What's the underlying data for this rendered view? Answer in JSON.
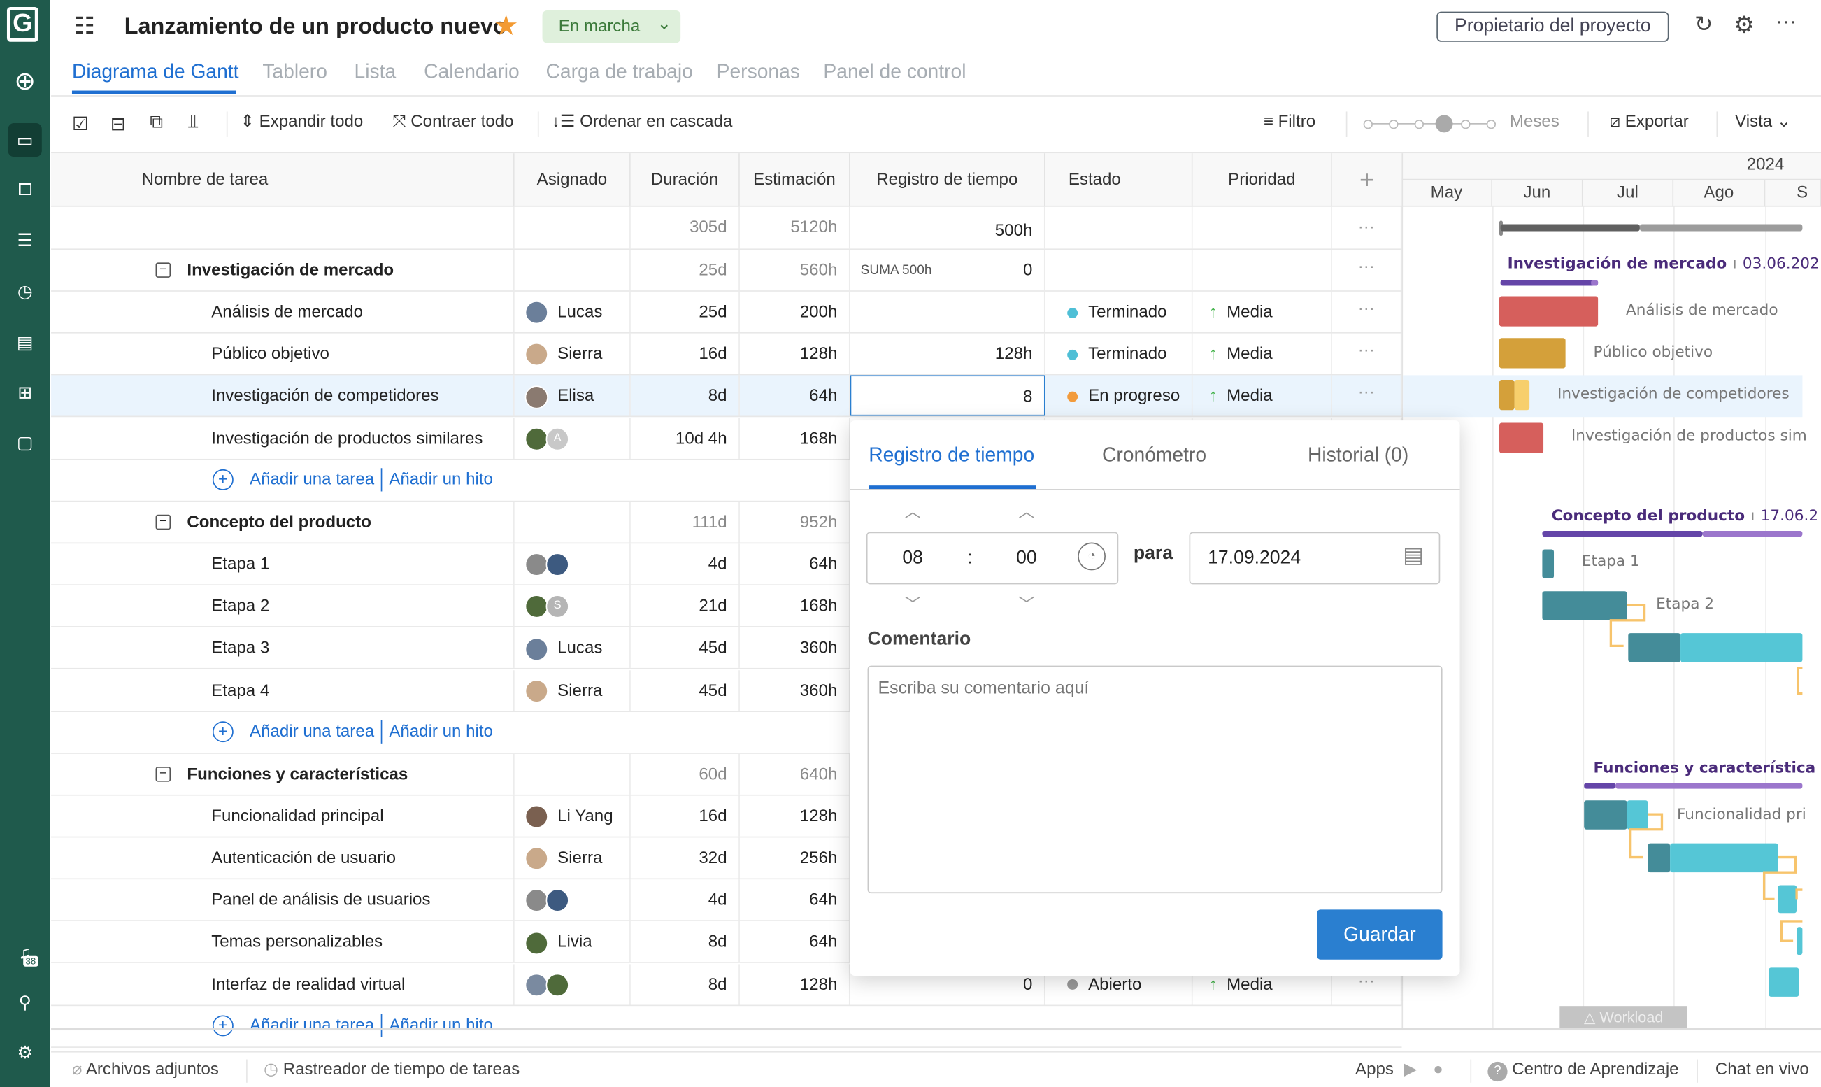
{
  "sidebar": {
    "logo": "G",
    "notification_count": "38"
  },
  "header": {
    "title": "Lanzamiento de un producto nuevo",
    "status": "En marcha",
    "owner_button": "Propietario del proyecto"
  },
  "tabs": [
    "Diagrama de Gantt",
    "Tablero",
    "Lista",
    "Calendario",
    "Carga de trabajo",
    "Personas",
    "Panel de control"
  ],
  "toolbar": {
    "expand": "Expandir todo",
    "collapse": "Contraer todo",
    "cascade": "Ordenar en cascada",
    "filter": "Filtro",
    "zoom_level": "Meses",
    "export": "Exportar",
    "view": "Vista"
  },
  "columns": [
    "Nombre de tarea",
    "Asignado",
    "Duración",
    "Estimación",
    "Registro de tiempo",
    "Estado",
    "Prioridad"
  ],
  "totals": {
    "duration": "305d",
    "estimate": "5120h",
    "timelog": "500h"
  },
  "add_task": "Añadir una tarea",
  "add_milestone": "Añadir un hito",
  "rows": [
    {
      "type": "group",
      "name": "Investigación de mercado",
      "duration": "25d",
      "estimate": "560h",
      "timelog_sum": "SUMA 500h",
      "timelog": "0"
    },
    {
      "type": "task",
      "name": "Análisis de mercado",
      "assignees": [
        {
          "name": "Lucas",
          "color": "#6b7f9a"
        }
      ],
      "duration": "25d",
      "estimate": "200h",
      "timelog": "",
      "status": "Terminado",
      "status_color": "#4fbfd6",
      "priority": "Media"
    },
    {
      "type": "task",
      "name": "Público objetivo",
      "assignees": [
        {
          "name": "Sierra",
          "color": "#c9a98a"
        }
      ],
      "duration": "16d",
      "estimate": "128h",
      "timelog": "128h",
      "status": "Terminado",
      "status_color": "#4fbfd6",
      "priority": "Media"
    },
    {
      "type": "task",
      "name": "Investigación de competidores",
      "assignees": [
        {
          "name": "Elisa",
          "color": "#8a7a70"
        }
      ],
      "duration": "8d",
      "estimate": "64h",
      "timelog": "8",
      "status": "En progreso",
      "status_color": "#f29b3c",
      "priority": "Media",
      "selected": true
    },
    {
      "type": "task",
      "name": "Investigación de productos similares",
      "assignees": [
        {
          "color": "#4f6a3a"
        },
        {
          "initial": "A",
          "color": "#c8c8c8"
        }
      ],
      "duration": "10d 4h",
      "estimate": "168h"
    },
    {
      "type": "add"
    },
    {
      "type": "group",
      "name": "Concepto del producto",
      "duration": "111d",
      "estimate": "952h"
    },
    {
      "type": "task",
      "name": "Etapa 1",
      "assignees": [
        {
          "color": "#8a8a8a"
        },
        {
          "color": "#3d5a80"
        }
      ],
      "duration": "4d",
      "estimate": "64h"
    },
    {
      "type": "task",
      "name": "Etapa 2",
      "assignees": [
        {
          "color": "#4f6a3a"
        },
        {
          "initial": "S",
          "color": "#b5b5b5"
        }
      ],
      "duration": "21d",
      "estimate": "168h"
    },
    {
      "type": "task",
      "name": "Etapa 3",
      "assignees": [
        {
          "name": "Lucas",
          "color": "#6b7f9a"
        }
      ],
      "duration": "45d",
      "estimate": "360h"
    },
    {
      "type": "task",
      "name": "Etapa 4",
      "assignees": [
        {
          "name": "Sierra",
          "color": "#c9a98a"
        }
      ],
      "duration": "45d",
      "estimate": "360h"
    },
    {
      "type": "add"
    },
    {
      "type": "group",
      "name": "Funciones y características",
      "duration": "60d",
      "estimate": "640h"
    },
    {
      "type": "task",
      "name": "Funcionalidad principal",
      "assignees": [
        {
          "name": "Li Yang",
          "color": "#7a6050"
        }
      ],
      "duration": "16d",
      "estimate": "128h"
    },
    {
      "type": "task",
      "name": "Autenticación de usuario",
      "assignees": [
        {
          "name": "Sierra",
          "color": "#c9a98a"
        }
      ],
      "duration": "32d",
      "estimate": "256h"
    },
    {
      "type": "task",
      "name": "Panel de análisis de usuarios",
      "assignees": [
        {
          "color": "#8a8a8a"
        },
        {
          "color": "#3d5a80"
        }
      ],
      "duration": "4d",
      "estimate": "64h"
    },
    {
      "type": "task",
      "name": "Temas personalizables",
      "assignees": [
        {
          "name": "Livia",
          "color": "#4f6a3a"
        }
      ],
      "duration": "8d",
      "estimate": "64h"
    },
    {
      "type": "task",
      "name": "Interfaz de realidad virtual",
      "assignees": [
        {
          "color": "#7a8aa0"
        },
        {
          "color": "#4f6a3a"
        }
      ],
      "duration": "8d",
      "estimate": "128h",
      "timelog": "0",
      "status": "Abierto",
      "status_color": "#999999",
      "priority": "Media"
    },
    {
      "type": "add"
    }
  ],
  "gantt": {
    "year": "2024",
    "months": [
      "May",
      "Jun",
      "Jul",
      "Ago",
      "S"
    ],
    "group_labels": [
      "Investigación de mercado",
      "Concepto del producto",
      "Funciones y característica"
    ],
    "group_dates": [
      "03.06.202",
      "17.06.2",
      ""
    ],
    "task_labels": [
      "Análisis de mercado",
      "Público objetivo",
      "Investigación de competidores",
      "Investigación de productos sim",
      "Etapa 1",
      "Etapa 2",
      "Funcionalidad pri"
    ],
    "workload": "Workload",
    "colors": {
      "red": "#d65f5c",
      "gold": "#d4a03a",
      "gold_light": "#f7cf6c",
      "teal_dark": "#448c99",
      "teal": "#55c6d6",
      "purple": "#6445a8",
      "purple_light": "#9b76cc",
      "link": "#f7c46c"
    }
  },
  "popup": {
    "tabs": [
      "Registro de tiempo",
      "Cronómetro",
      "Historial (0)"
    ],
    "hours": "08",
    "minutes": "00",
    "separator": ":",
    "for_label": "para",
    "date": "17.09.2024",
    "comment_label": "Comentario",
    "comment_placeholder": "Escriba su comentario aquí",
    "save": "Guardar"
  },
  "footer": {
    "attachments": "Archivos adjuntos",
    "time_tracker": "Rastreador de tiempo de tareas",
    "apps": "Apps",
    "learning": "Centro de Aprendizaje",
    "chat": "Chat en vivo"
  }
}
